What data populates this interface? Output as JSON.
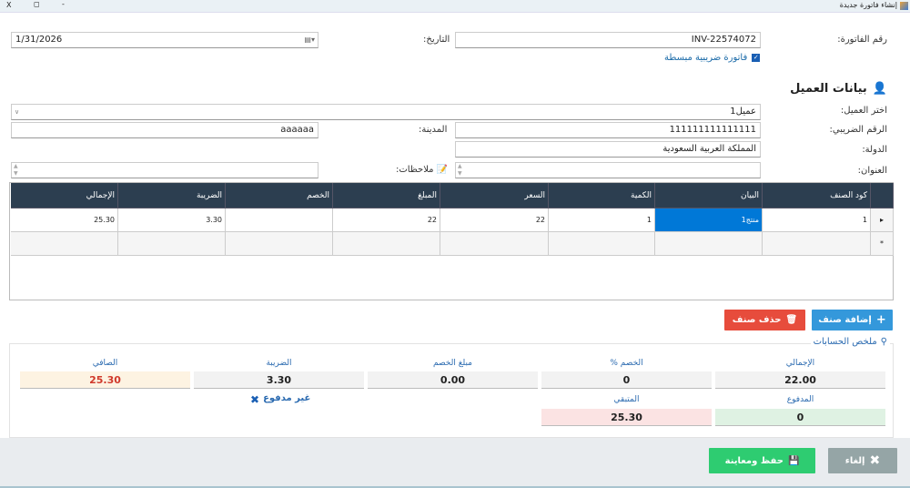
{
  "window": {
    "title": "إنشاء فاتورة جديدة",
    "close": "X",
    "restore": "◻",
    "minimize": "-"
  },
  "form": {
    "invoice_label": "رقم الفاتورة:",
    "invoice_value": "INV-22574072",
    "date_label": "التاريخ:",
    "date_value": "1/31/2026",
    "simplified_label": "فاتورة ضريبية مبسطة",
    "simplified_checked": true,
    "client_section": "بيانات العميل",
    "client_label": "اختر العميل:",
    "client_value": "عميل1",
    "tax_label": "الرقم الضريبي:",
    "tax_value": "111111111111111",
    "city_label": "المدينة:",
    "city_value": "aaaaaa",
    "country_label": "الدولة:",
    "country_value": "المملكة العربية السعودية",
    "address_label": "العنوان:",
    "address_value": "",
    "notes_label": "ملاحظات:",
    "notes_value": ""
  },
  "grid": {
    "columns": [
      "كود الصنف",
      "البيان",
      "الكمية",
      "السعر",
      "المبلغ",
      "الخصم",
      "الضريبة",
      "الإجمالي"
    ],
    "rows": [
      [
        "1",
        "منتج1",
        "1",
        "22",
        "22",
        "",
        "3.30",
        "25.30"
      ]
    ]
  },
  "actions": {
    "add_item": "إضافة صنف",
    "delete_item": "حذف صنف"
  },
  "summary": {
    "title": "ملخص الحسابات",
    "total_label": "الإجمالي",
    "total": "22.00",
    "discount_pct_label": "الخصم %",
    "discount_pct": "0",
    "discount_amt_label": "مبلغ الخصم",
    "discount_amt": "0.00",
    "tax_label": "الضريبة",
    "tax": "3.30",
    "net_label": "الصافي",
    "net": "25.30",
    "paid_label": "المدفوع",
    "paid": "0",
    "remaining_label": "المتبقي",
    "remaining": "25.30",
    "status": "غير مدفوع"
  },
  "footer": {
    "save": "حفظ ومعاينة",
    "cancel": "إلغاء"
  },
  "colors": {
    "header": "#2c3e50",
    "add": "#3498db",
    "delete": "#e74c3c",
    "save": "#2ecc71",
    "cancel": "#95a5a6",
    "selected": "#0078d7"
  }
}
